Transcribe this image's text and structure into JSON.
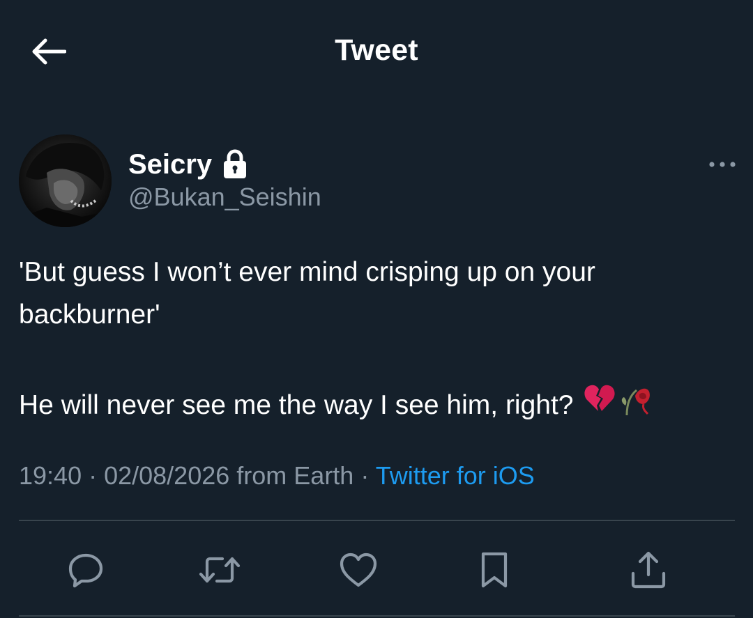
{
  "header": {
    "title": "Tweet",
    "back_icon": "arrow-left-icon"
  },
  "tweet": {
    "author": {
      "display_name": "Seicry",
      "handle": "@Bukan_Seishin",
      "protected_icon": "lock-icon",
      "avatar": "avatar-photo"
    },
    "more_icon": "more-horizontal-icon",
    "text_line_1": "'But guess I won’t ever mind crisping up on your backburner'",
    "text_line_2": "He will never see me the way I see him, right?",
    "emojis": [
      "broken-heart-emoji",
      "wilted-flower-emoji"
    ],
    "meta": {
      "time": "19:40",
      "separator_1": " · ",
      "date": "02/08/2026",
      "location_text": " from Earth",
      "separator_2": " · ",
      "source": "Twitter for iOS"
    }
  },
  "actions": [
    {
      "icon": "reply-icon"
    },
    {
      "icon": "retweet-icon"
    },
    {
      "icon": "like-icon"
    },
    {
      "icon": "bookmark-icon"
    },
    {
      "icon": "share-icon"
    }
  ],
  "colors": {
    "background": "#15202b",
    "text_primary": "#ffffff",
    "text_secondary": "#8b98a5",
    "link": "#1d9bf0",
    "divider": "#38444d"
  }
}
